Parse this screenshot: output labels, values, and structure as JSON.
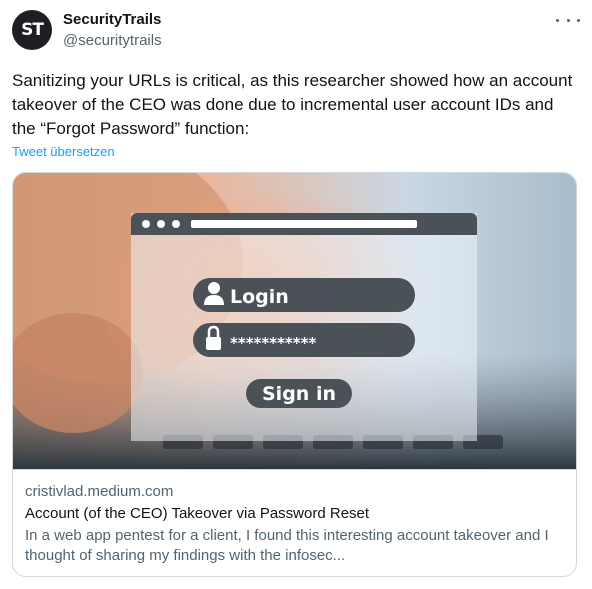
{
  "author": {
    "avatar_initials": "ST",
    "name": "SecurityTrails",
    "handle": "@securitytrails"
  },
  "more_icon": "more-horizontal-icon",
  "tweet": {
    "text": "Sanitizing your URLs is critical, as this researcher showed how an account takeover of the CEO was done due to incremental user account IDs and the “Forgot Password” function:",
    "translate_label": "Tweet übersetzen"
  },
  "card": {
    "image": {
      "login_label": "Login",
      "password_mask": "***********",
      "signin_label": "Sign in"
    },
    "domain": "cristivlad.medium.com",
    "title": "Account (of the CEO) Takeover via Password Reset",
    "description": "In a web app pentest for a client, I found this interesting account takeover and I thought of sharing my findings with the infosec..."
  },
  "colors": {
    "link": "#1d9bf0",
    "text": "#0f1419",
    "secondary": "#536471",
    "border": "#cfd9de"
  }
}
